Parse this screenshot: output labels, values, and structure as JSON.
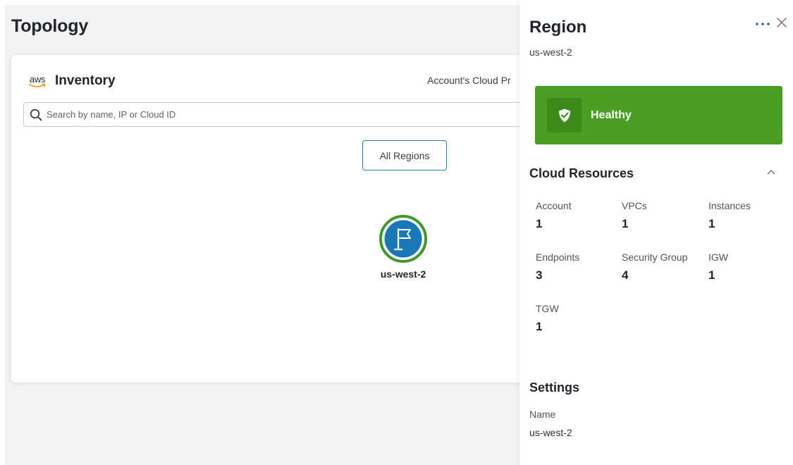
{
  "page": {
    "title": "Topology"
  },
  "inventory": {
    "logo_text": "aws",
    "title": "Inventory",
    "right_label": "Account's Cloud Pr",
    "search_placeholder": "Search by name, IP or Cloud ID",
    "all_regions_label": "All Regions",
    "region_node": {
      "label": "us-west-2",
      "icon": "flag-icon",
      "ring_color": "#3f9a2a",
      "fill_color": "#1b78b8"
    }
  },
  "panel": {
    "title": "Region",
    "subtitle": "us-west-2",
    "more_icon": "more-horizontal-icon",
    "close_icon": "close-icon",
    "health": {
      "label": "Healthy",
      "color": "#4a9e23",
      "icon": "shield-check-icon"
    },
    "cloud_resources": {
      "title": "Cloud Resources",
      "items": [
        {
          "label": "Account",
          "value": "1"
        },
        {
          "label": "VPCs",
          "value": "1"
        },
        {
          "label": "Instances",
          "value": "1"
        },
        {
          "label": "Endpoints",
          "value": "3"
        },
        {
          "label": "Security Group",
          "value": "4"
        },
        {
          "label": "IGW",
          "value": "1"
        },
        {
          "label": "TGW",
          "value": "1"
        }
      ]
    },
    "settings": {
      "title": "Settings",
      "name_label": "Name",
      "name_value": "us-west-2"
    }
  }
}
